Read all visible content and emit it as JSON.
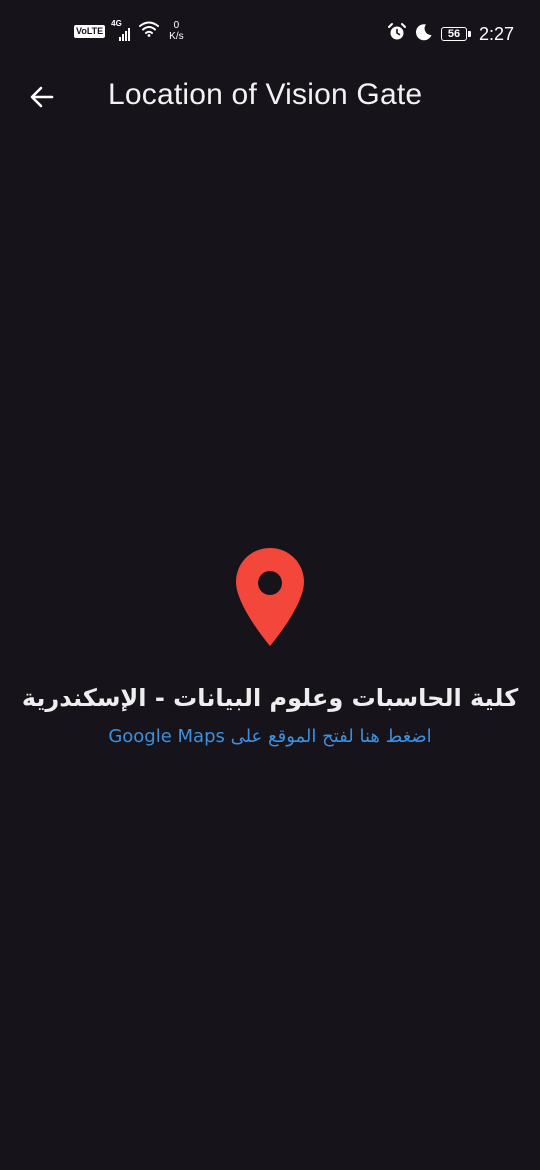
{
  "status_bar": {
    "volte": "VoLTE",
    "network": "4G",
    "speed_value": "0",
    "speed_unit": "K/s",
    "battery": "56",
    "time": "2:27"
  },
  "app_bar": {
    "title": "Location of Vision Gate"
  },
  "location": {
    "name": "كلية الحاسبات وعلوم البيانات - الإسكندرية",
    "maps_link": "اضغط هنا لفتح الموقع على Google Maps",
    "pin_color": "#f2473a",
    "link_color": "#3d8fe0"
  },
  "colors": {
    "background": "#16141a"
  }
}
